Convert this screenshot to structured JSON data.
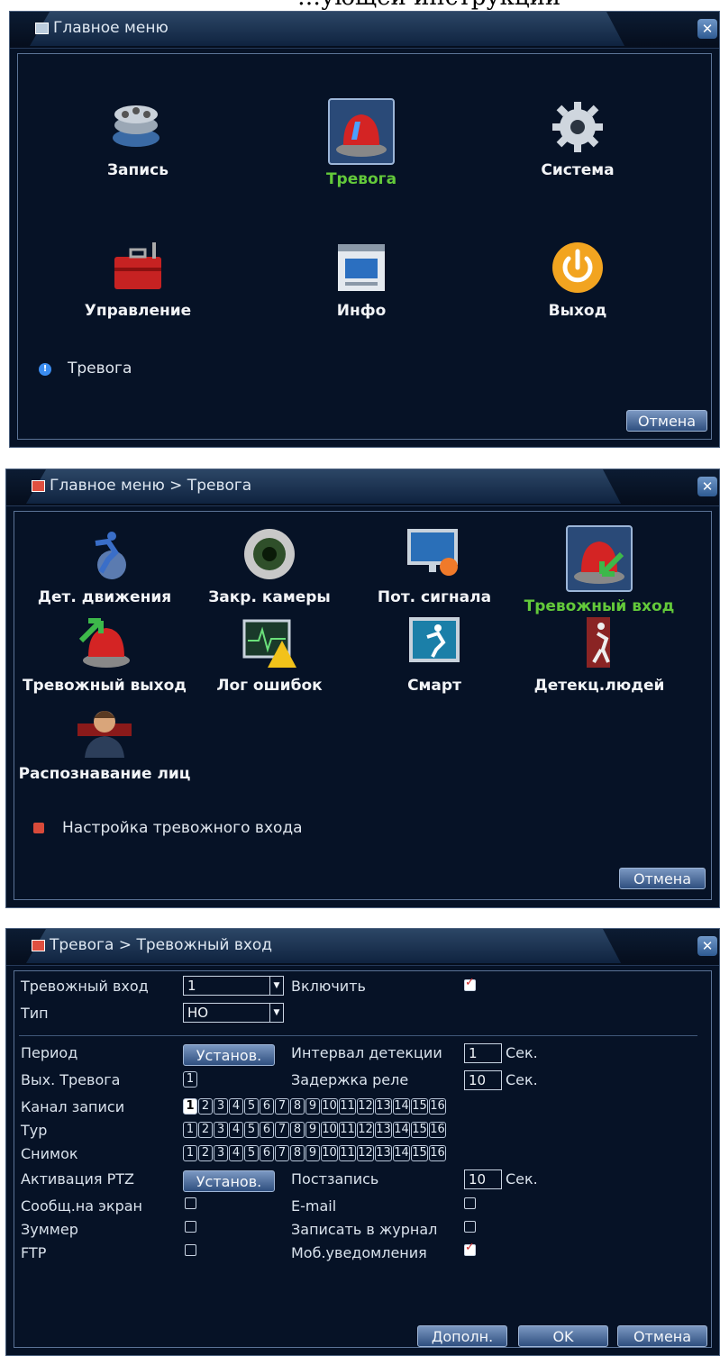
{
  "top_caption": "…ующей инструкций",
  "panel1": {
    "title": "Главное меню",
    "items": [
      {
        "label": "Запись",
        "icon": "film-reel-icon"
      },
      {
        "label": "Тревога",
        "icon": "alarm-siren-icon",
        "selected": true
      },
      {
        "label": "Система",
        "icon": "gear-icon"
      },
      {
        "label": "Управление",
        "icon": "toolbox-icon"
      },
      {
        "label": "Инфо",
        "icon": "info-window-icon"
      },
      {
        "label": "Выход",
        "icon": "power-icon"
      }
    ],
    "status": "Тревога",
    "cancel": "Отмена"
  },
  "panel2": {
    "title": "Главное меню > Тревога",
    "items": [
      {
        "label": "Дет. движения",
        "icon": "motion-detect-icon"
      },
      {
        "label": "Закр. камеры",
        "icon": "camera-blind-icon"
      },
      {
        "label": "Пот. сигнала",
        "icon": "video-loss-icon"
      },
      {
        "label": "Тревожный вход",
        "icon": "alarm-input-icon",
        "selected": true
      },
      {
        "label": "Тревожный выход",
        "icon": "alarm-output-icon"
      },
      {
        "label": "Лог ошибок",
        "icon": "error-log-icon"
      },
      {
        "label": "Смарт",
        "icon": "smart-icon"
      },
      {
        "label": "Детекц.людей",
        "icon": "human-detect-icon"
      },
      {
        "label": "Распознавание лиц",
        "icon": "face-recognition-icon"
      }
    ],
    "status": "Настройка тревожного входа",
    "cancel": "Отмена"
  },
  "panel3": {
    "title": "Тревога > Тревожный вход",
    "alarm_input_label": "Тревожный вход",
    "alarm_input_value": "1",
    "enable_label": "Включить",
    "enable_checked": true,
    "type_label": "Тип",
    "type_value": "НО",
    "period_label": "Период",
    "set_label": "Установ.",
    "interval_label": "Интервал детекции",
    "interval_value": "1",
    "sec": "Сек.",
    "alarm_out_label": "Вых. Тревога",
    "alarm_out_value": "1",
    "relay_delay_label": "Задержка реле",
    "relay_delay_value": "10",
    "rec_channel_label": "Канал записи",
    "tour_label": "Тур",
    "snapshot_label": "Снимок",
    "channels": [
      "1",
      "2",
      "3",
      "4",
      "5",
      "6",
      "7",
      "8",
      "9",
      "10",
      "11",
      "12",
      "13",
      "14",
      "15",
      "16"
    ],
    "rec_channel_selected": [
      "1"
    ],
    "ptz_label": "Активация PTZ",
    "postrec_label": "Постзапись",
    "postrec_value": "10",
    "osd_label": "Сообщ.на экран",
    "osd_checked": false,
    "email_label": "E-mail",
    "email_checked": false,
    "buzzer_label": "Зуммер",
    "buzzer_checked": false,
    "log_label": "Записать в журнал",
    "log_checked": false,
    "ftp_label": "FTP",
    "ftp_checked": false,
    "mobile_label": "Моб.уведомления",
    "mobile_checked": true,
    "advanced": "Дополн.",
    "ok": "OK",
    "cancel": "Отмена"
  }
}
